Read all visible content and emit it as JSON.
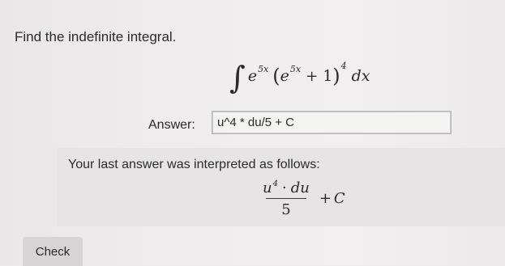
{
  "question": {
    "prompt": "Find the indefinite integral.",
    "integral": {
      "sign": "∫",
      "base_e": "e",
      "exp_outer_e": "5x",
      "lparen": "(",
      "inner_e": "e",
      "exp_inner_e": "5x",
      "plus": "+",
      "one": "1",
      "rparen": ")",
      "power": "4",
      "differential": "dx"
    }
  },
  "answer": {
    "label": "Answer:",
    "value": "u^4 * du/5 + C"
  },
  "interpretation": {
    "text": "Your last answer was interpreted as follows:",
    "numerator_u": "u",
    "numerator_power": "4",
    "numerator_dot": "·",
    "numerator_du": "du",
    "denominator": "5",
    "plus": "+",
    "constant": "C"
  },
  "actions": {
    "check_label": "Check"
  }
}
